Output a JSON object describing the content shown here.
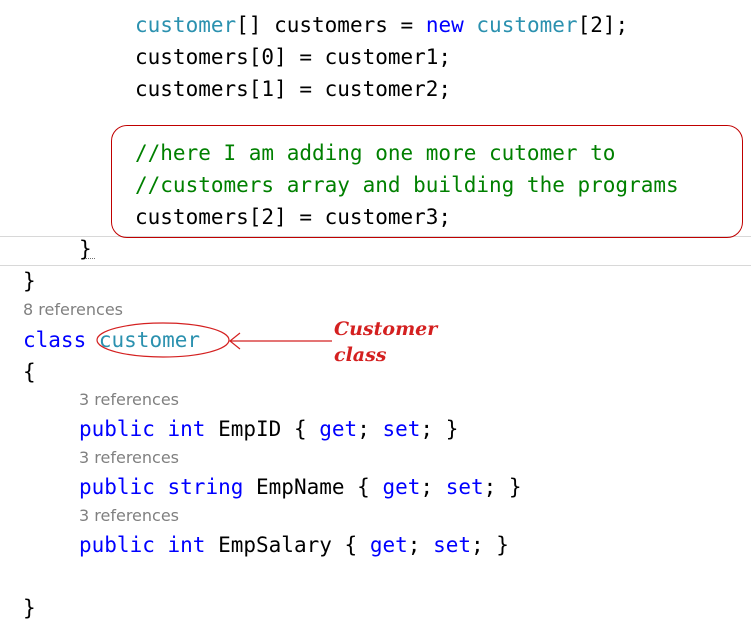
{
  "code": {
    "line1": {
      "type": "customer",
      "a": "[] customers = ",
      "new": "new",
      "sp": " ",
      "type2": "customer",
      "b": "[2];"
    },
    "line2": "customers[0] = customer1;",
    "line3": "customers[1] = customer2;",
    "comment1": "//here I am adding one more cutomer to",
    "comment2": "//customers array and building the programs",
    "line6": "customers[2] = customer3;",
    "close_inner": "}",
    "close_outer": "}",
    "class_refs": "8 references",
    "class_kw": "class",
    "class_name": "customer",
    "open_brace": "{",
    "prop1_refs": "3 references",
    "prop1": {
      "public": "public",
      "type": "int",
      "name": " EmpID { ",
      "get": "get",
      "sep": "; ",
      "set": "set",
      "end": "; }"
    },
    "prop2_refs": "3 references",
    "prop2": {
      "public": "public",
      "type": "string",
      "name": " EmpName { ",
      "get": "get",
      "sep": "; ",
      "set": "set",
      "end": "; }"
    },
    "prop3_refs": "3 references",
    "prop3": {
      "public": "public",
      "type": "int",
      "name": " EmpSalary { ",
      "get": "get",
      "sep": "; ",
      "set": "set",
      "end": "; }"
    },
    "close_class": "}"
  },
  "annotation": {
    "line1": "Customer",
    "line2": "class"
  },
  "colors": {
    "type": "#2b91af",
    "keyword": "#0000ff",
    "comment": "#008000",
    "annotation": "#d42020",
    "references": "#808080"
  }
}
